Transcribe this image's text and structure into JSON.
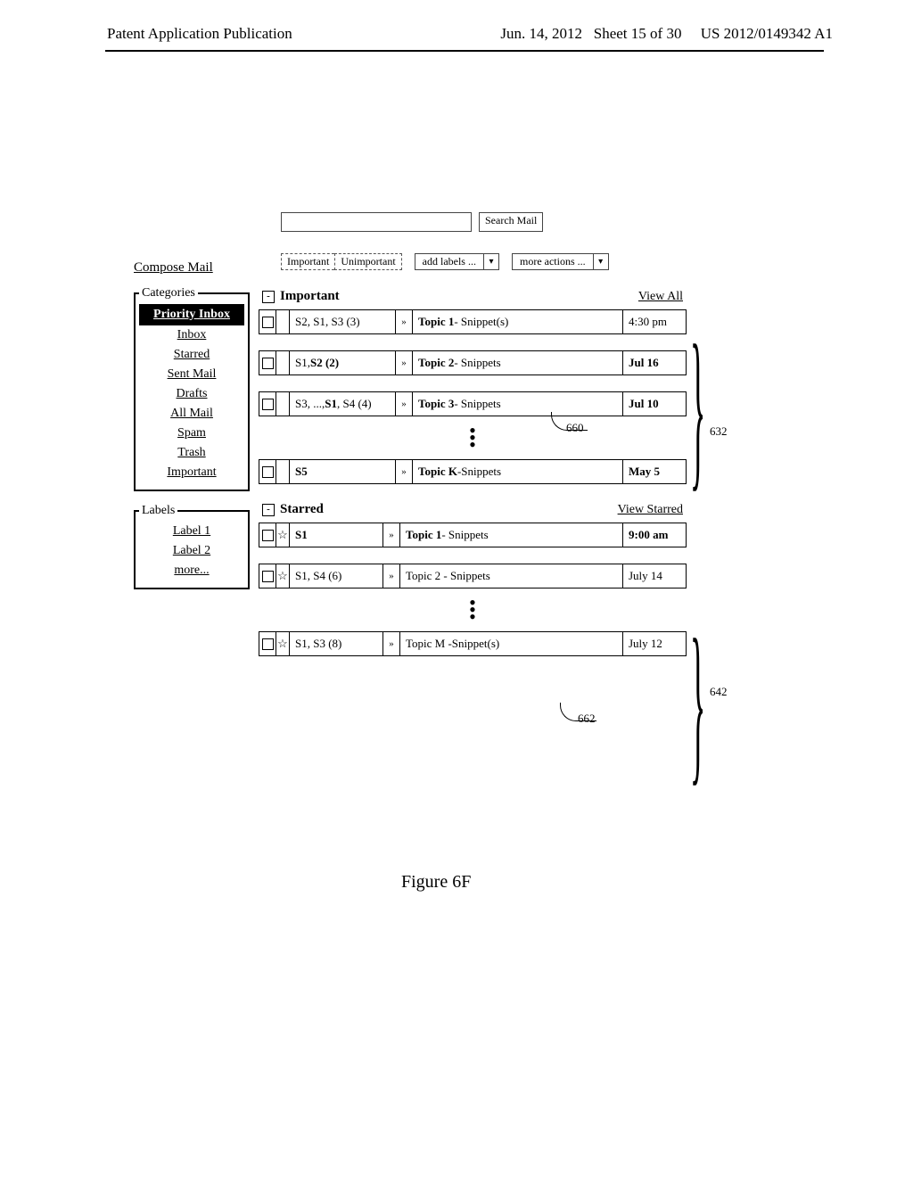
{
  "header": {
    "left": "Patent Application Publication",
    "date": "Jun. 14, 2012",
    "sheet": "Sheet 15 of 30",
    "pubno": "US 2012/0149342 A1"
  },
  "search": {
    "button": "Search Mail"
  },
  "toolbar": {
    "important": "Important",
    "unimportant": "Unimportant",
    "add_labels": "add labels ...",
    "more_actions": "more actions ..."
  },
  "compose": "Compose Mail",
  "sidebar": {
    "categories_legend": "Categories",
    "categories": [
      "Priority Inbox",
      "Inbox",
      "Starred",
      "Sent Mail",
      "Drafts",
      "All Mail",
      "Spam",
      "Trash",
      "Important"
    ],
    "labels_legend": "Labels",
    "labels": [
      "Label 1",
      "Label 2",
      "more..."
    ]
  },
  "sections": {
    "important": {
      "title": "Important",
      "view": "View All",
      "rows": [
        {
          "senders": "S2, S1, S3 (3)",
          "mark": "»",
          "topic_b": "Topic 1",
          "topic_t": " - Snippet(s)",
          "date": "4:30 pm",
          "bold": false
        },
        {
          "senders_html": "S1, <b>S2 (2)</b>",
          "mark": "»",
          "topic_b": "Topic 2",
          "topic_t": " - Snippets",
          "date": "Jul 16",
          "bold": true
        },
        {
          "senders_html": "S3, ..., <b>S1</b>, S4 (4)",
          "mark": "»",
          "topic_b": "Topic 3",
          "topic_t": " - Snippets",
          "date": "Jul 10",
          "bold": true
        },
        {
          "senders_html": "<b>S5</b>",
          "mark": "»",
          "topic_b": "Topic K",
          "topic_t": "-Snippets",
          "date": "May 5",
          "bold": true
        }
      ]
    },
    "starred": {
      "title": "Starred",
      "view": "View Starred",
      "rows": [
        {
          "senders_html": "<b>S1</b>",
          "mark": "»",
          "topic_b": "Topic 1",
          "topic_t": " - Snippets",
          "date": "9:00 am",
          "bold": true
        },
        {
          "senders": "S1, S4 (6)",
          "mark": "»",
          "topic_b": "",
          "topic_t": "Topic 2 - Snippets",
          "date": "July 14",
          "bold": false
        },
        {
          "senders": "S1, S3 (8)",
          "mark": "»",
          "topic_b": "",
          "topic_t": "Topic M -Snippet(s)",
          "date": "July 12",
          "bold": false
        }
      ]
    }
  },
  "callouts": {
    "c660": "660",
    "c662": "662",
    "b632": "632",
    "b642": "642"
  },
  "figure": "Figure 6F"
}
